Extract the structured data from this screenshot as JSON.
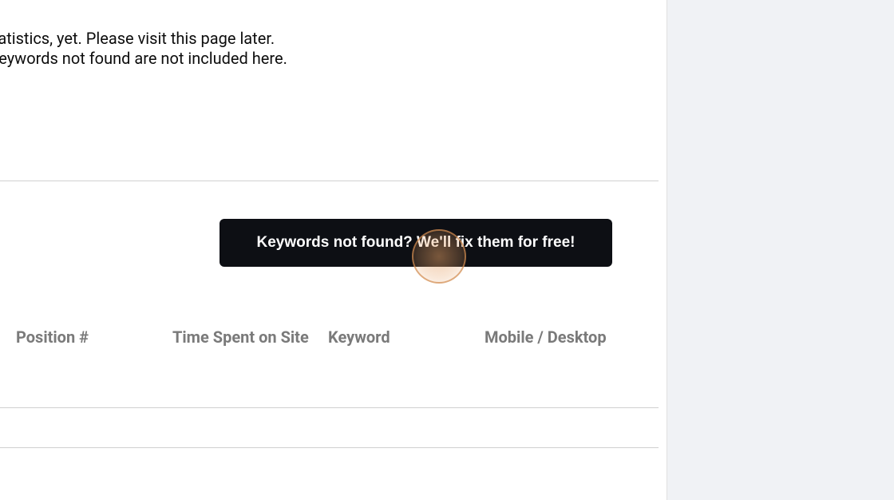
{
  "info": {
    "line1": "are no statistics, yet. Please visit this page later.",
    "line2": "es with keywords not found are not included here."
  },
  "cta": {
    "label": "Keywords not found? We'll fix them for free!"
  },
  "table": {
    "headers": {
      "position": "Position #",
      "time_spent": "Time Spent on Site",
      "keyword": "Keyword",
      "mobile_desktop": "Mobile / Desktop"
    }
  }
}
